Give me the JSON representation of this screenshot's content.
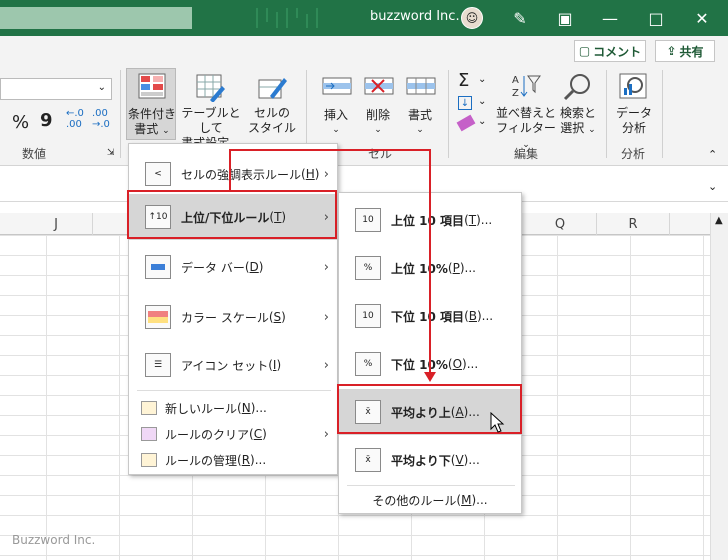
{
  "titlebar": {
    "user_name": "buzzword Inc."
  },
  "ribbon": {
    "comment_label": "コメント",
    "share_label": "共有",
    "percent": "%",
    "comma": "9",
    "dec_inc": "←.0\n.00",
    "dec_dec": ".00\n→.0",
    "group_number": "数値",
    "cond_format_1": "条件付き",
    "cond_format_2": "書式",
    "table_format_1": "テーブルとして",
    "table_format_2": "書式設定",
    "cell_style_1": "セルの",
    "cell_style_2": "スタイル",
    "insert": "挿入",
    "delete": "削除",
    "format": "書式",
    "group_cell": "セル",
    "sigma": "Σ",
    "sort_filter_1": "並べ替えと",
    "sort_filter_2": "フィルター",
    "find_select_1": "検索と",
    "find_select_2": "選択",
    "group_edit": "編集",
    "data_analysis_1": "データ",
    "data_analysis_2": "分析",
    "group_analysis": "分析"
  },
  "columns": [
    "J",
    "Q",
    "R"
  ],
  "menu1": {
    "items": [
      {
        "label": "セルの強調表示ルール",
        "key": "H"
      },
      {
        "label": "上位/下位ルール",
        "key": "T"
      },
      {
        "label": "データ バー",
        "key": "D"
      },
      {
        "label": "カラー スケール",
        "key": "S"
      },
      {
        "label": "アイコン セット",
        "key": "I"
      }
    ],
    "small_items": [
      {
        "label": "新しいルール",
        "key": "N",
        "suffix": "..."
      },
      {
        "label": "ルールのクリア",
        "key": "C",
        "suffix": ""
      },
      {
        "label": "ルールの管理",
        "key": "R",
        "suffix": "..."
      }
    ]
  },
  "menu2": {
    "items": [
      {
        "label": "上位 10 項目",
        "key": "T",
        "icon": "10"
      },
      {
        "label": "上位 10%",
        "key": "P",
        "icon": "%"
      },
      {
        "label": "下位 10 項目",
        "key": "B",
        "icon": "10"
      },
      {
        "label": "下位 10%",
        "key": "O",
        "icon": "%"
      },
      {
        "label": "平均より上",
        "key": "A",
        "icon": "x̄"
      },
      {
        "label": "平均より下",
        "key": "V",
        "icon": "x̄"
      }
    ],
    "other": {
      "label": "その他のルール",
      "key": "M"
    }
  },
  "watermark": "Buzzword Inc.",
  "colors": {
    "titlebar": "#217346",
    "highlight": "#d92027"
  }
}
